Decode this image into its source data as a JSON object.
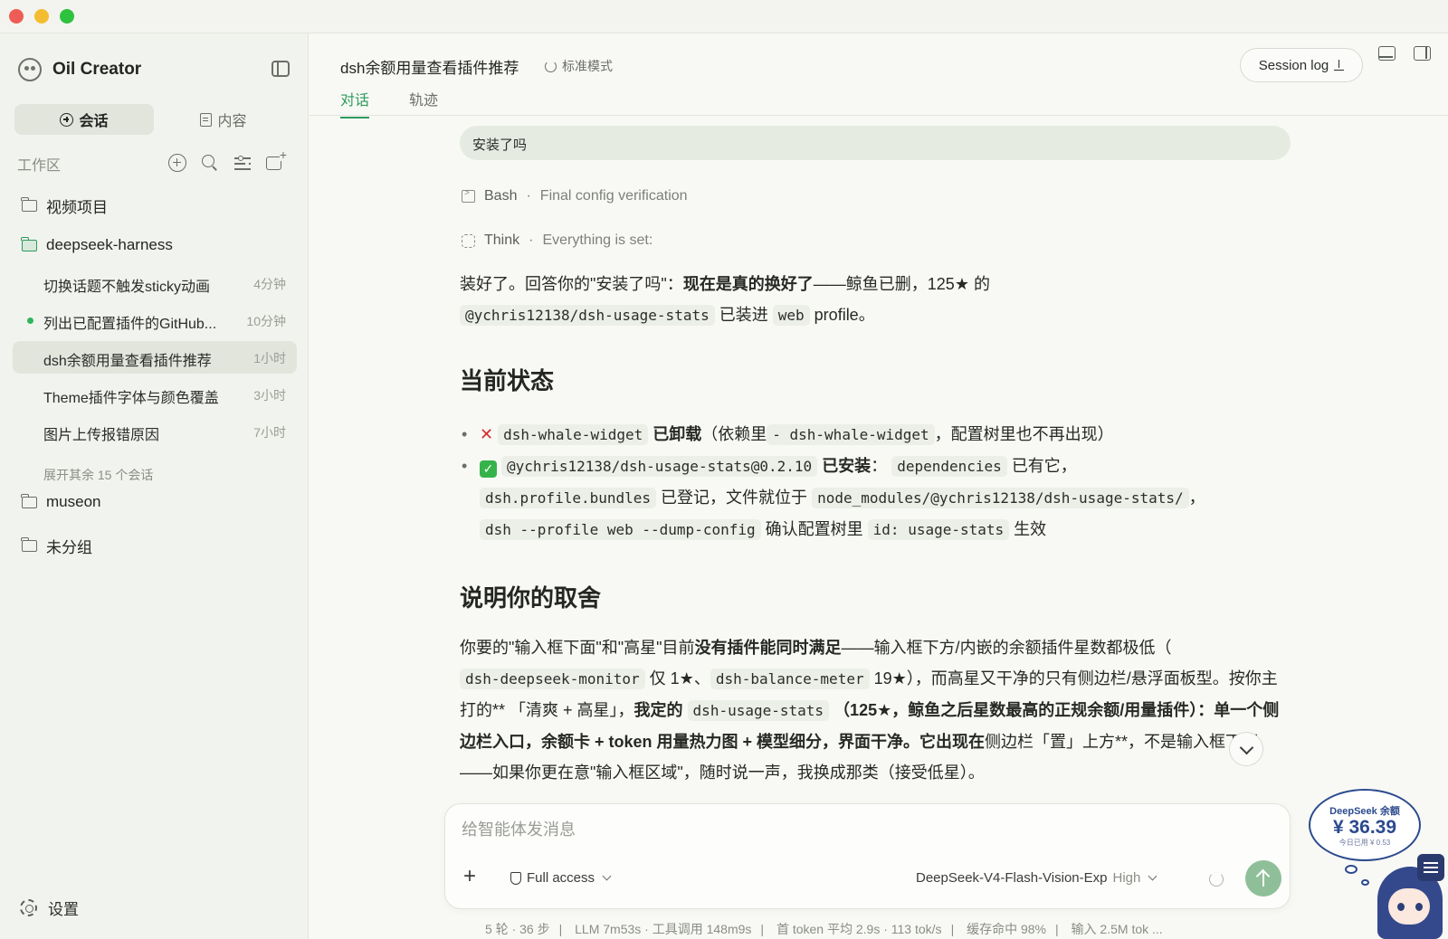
{
  "app": {
    "name": "Oil Creator"
  },
  "sidebar": {
    "seg_chat": "会话",
    "seg_content": "内容",
    "workspace_label": "工作区",
    "folders": [
      {
        "name": "视频项目"
      },
      {
        "name": "deepseek-harness"
      },
      {
        "name": "museon"
      },
      {
        "name": "未分组"
      }
    ],
    "sessions": [
      {
        "title": "切换话题不触发sticky动画",
        "time": "4分钟"
      },
      {
        "title": "列出已配置插件的GitHub...",
        "time": "10分钟"
      },
      {
        "title": "dsh余额用量查看插件推荐",
        "time": "1小时"
      },
      {
        "title": "Theme插件字体与颜色覆盖",
        "time": "3小时"
      },
      {
        "title": "图片上传报错原因",
        "time": "7小时"
      }
    ],
    "more_sessions": "展开其余 15 个会话",
    "settings": "设置"
  },
  "header": {
    "title": "dsh余额用量查看插件推荐",
    "mode": "标准模式",
    "tabs": [
      "对话",
      "轨迹"
    ],
    "session_log": "Session log"
  },
  "conversation": {
    "user_message": "安装了吗",
    "steps": [
      {
        "tool": "Bash",
        "desc": "Final config verification"
      },
      {
        "tool": "Think",
        "desc": "Everything is set:"
      }
    ],
    "intro_a": "装好了。回答你的\"安装了吗\"：",
    "intro_bold": "现在是真的换好了",
    "intro_b": "——鲸鱼已删，125★ 的",
    "intro_code1": "@ychris12138/dsh-usage-stats",
    "intro_c": "已装进",
    "intro_code2": "web",
    "intro_d": "profile。",
    "h_status": "当前状态",
    "b1_code": "dsh-whale-widget",
    "b1_bold": "已卸载",
    "b1_a": "（依赖里",
    "b1_code2": "- dsh-whale-widget",
    "b1_b": "，配置树里也不再出现）",
    "b2_code": "@ychris12138/dsh-usage-stats@0.2.10",
    "b2_bold": "已安装",
    "b2_a": "：",
    "b2_code2": "dependencies",
    "b2_b": "已有它，",
    "b2_code3": "dsh.profile.bundles",
    "b2_c": "已登记，文件就位于",
    "b2_code4": "node_modules/@ychris12138/dsh-usage-stats/",
    "b2_d": "，",
    "b2_code5": "dsh --profile web --dump-config",
    "b2_e": "确认配置树里",
    "b2_code6": "id: usage-stats",
    "b2_f": "生效",
    "h_tradeoff": "说明你的取舍",
    "p_a": "你要的\"输入框下面\"和\"高星\"目前",
    "p_bold1": "没有插件能同时满足",
    "p_b": "——输入框下方/内嵌的余额插件星数都极低（",
    "p_code1": "dsh-deepseek-monitor",
    "p_c": "仅 1★、",
    "p_code2": "dsh-balance-meter",
    "p_d": "19★），而高星又干净的只有侧边栏/悬浮面板型。按你主打的** 「清爽 + 高星」，",
    "p_bold2": "我定的",
    "p_code3": "dsh-usage-stats",
    "p_bold3": "（125★，鲸鱼之后星数最高的正规余额/用量插件）：单一个侧边栏入口，余额卡 + token 用量热力图 + 模型细分，界面干净。它出现在",
    "p_e": "侧边栏「",
    "p_f": "置」上方**，不是输入框下面——如果你更在意\"输入框区域\"，随时说一声，我换成那类（接受低星）。"
  },
  "composer": {
    "placeholder": "给智能体发消息",
    "access": "Full access",
    "model": "DeepSeek-V4-Flash-Vision-Exp",
    "level": "High"
  },
  "status": {
    "items": [
      "5 轮 · 36 步",
      "LLM 7m53s · 工具调用 148m9s",
      "首 token 平均 2.9s · 113 tok/s",
      "缓存命中 98%",
      "输入 2.5M tok ..."
    ]
  },
  "balance": {
    "label": "DeepSeek 余额",
    "value": "¥ 36.39",
    "today": "今日已用 ¥ 0.53"
  },
  "colors": {
    "accent": "#2e9a5a",
    "send": "#8fbf98",
    "balance": "#2b4a8e"
  }
}
